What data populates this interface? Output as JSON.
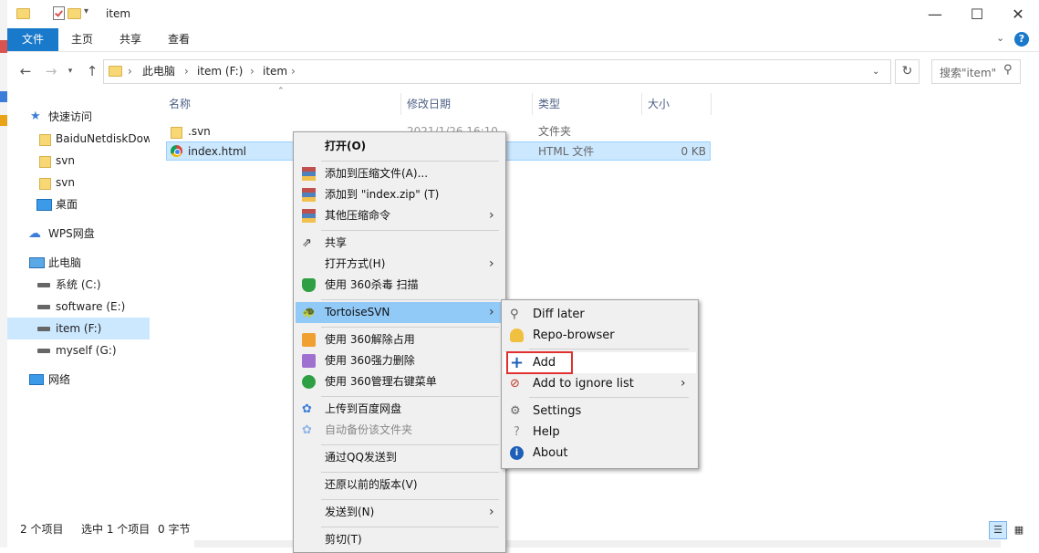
{
  "window": {
    "title": "item",
    "minimize": "—",
    "maximize": "☐",
    "close": "✕"
  },
  "ribbon": {
    "tabs": [
      "文件",
      "主页",
      "共享",
      "查看"
    ],
    "help": "?"
  },
  "address": {
    "crumbs": [
      "此电脑",
      "item (F:)",
      "item"
    ],
    "search_placeholder": "搜索\"item\""
  },
  "sidebar": {
    "items": [
      {
        "label": "快速访问"
      },
      {
        "label": "BaiduNetdiskDow"
      },
      {
        "label": "svn"
      },
      {
        "label": "svn"
      },
      {
        "label": "桌面"
      },
      {
        "label": "WPS网盘"
      },
      {
        "label": "此电脑"
      },
      {
        "label": "系统 (C:)"
      },
      {
        "label": "software (E:)"
      },
      {
        "label": "item (F:)"
      },
      {
        "label": "myself (G:)"
      },
      {
        "label": "网络"
      }
    ]
  },
  "columns": {
    "name": "名称",
    "date": "修改日期",
    "type": "类型",
    "size": "大小"
  },
  "files": [
    {
      "name": ".svn",
      "date": "2021/1/26 16:10",
      "type": "文件夹",
      "size": ""
    },
    {
      "name": "index.html",
      "date": "",
      "type": "HTML 文件",
      "size": "0 KB"
    }
  ],
  "status": {
    "count": "2 个项目",
    "selected": "选中 1 个项目",
    "bytes": "0 字节"
  },
  "context_menu": {
    "items": [
      "打开(O)",
      "添加到压缩文件(A)...",
      "添加到 \"index.zip\" (T)",
      "其他压缩命令",
      "共享",
      "打开方式(H)",
      "使用 360杀毒 扫描",
      "TortoiseSVN",
      "使用 360解除占用",
      "使用 360强力删除",
      "使用 360管理右键菜单",
      "上传到百度网盘",
      "自动备份该文件夹",
      "通过QQ发送到",
      "还原以前的版本(V)",
      "发送到(N)",
      "剪切(T)"
    ]
  },
  "svn_submenu": {
    "items": [
      "Diff later",
      "Repo-browser",
      "Add",
      "Add to ignore list",
      "Settings",
      "Help",
      "About"
    ],
    "highlight_color": "#e03030"
  }
}
